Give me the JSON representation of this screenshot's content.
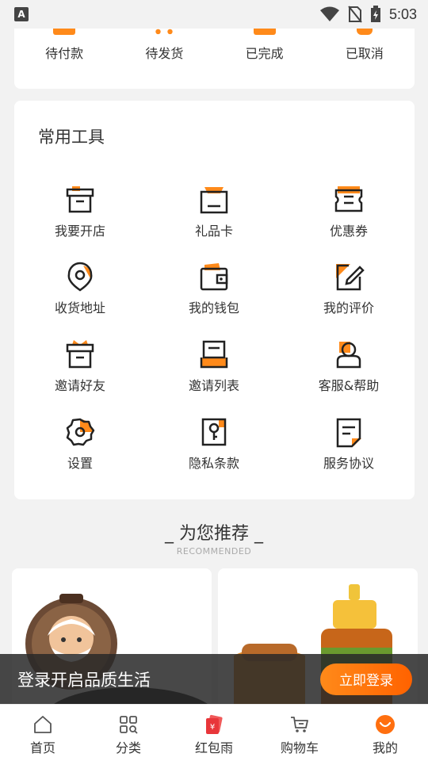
{
  "status_bar": {
    "time": "5:03",
    "app_badge": "A"
  },
  "orders": {
    "items": [
      {
        "label": "待付款"
      },
      {
        "label": "待发货"
      },
      {
        "label": "已完成"
      },
      {
        "label": "已取消"
      }
    ]
  },
  "tools": {
    "title": "常用工具",
    "items": [
      {
        "label": "我要开店",
        "icon": "store-box-icon"
      },
      {
        "label": "礼品卡",
        "icon": "gift-card-icon"
      },
      {
        "label": "优惠券",
        "icon": "coupon-icon"
      },
      {
        "label": "收货地址",
        "icon": "location-pin-icon"
      },
      {
        "label": "我的钱包",
        "icon": "wallet-icon"
      },
      {
        "label": "我的评价",
        "icon": "edit-review-icon"
      },
      {
        "label": "邀请好友",
        "icon": "invite-gift-icon"
      },
      {
        "label": "邀请列表",
        "icon": "invite-list-icon"
      },
      {
        "label": "客服&帮助",
        "icon": "customer-service-icon"
      },
      {
        "label": "设置",
        "icon": "gear-icon"
      },
      {
        "label": "隐私条款",
        "icon": "privacy-key-icon"
      },
      {
        "label": "服务协议",
        "icon": "agreement-doc-icon"
      }
    ]
  },
  "recommended": {
    "title": "_ 为您推荐 _",
    "subtitle": "RECOMMENDED"
  },
  "login_banner": {
    "text": "登录开启品质生活",
    "button": "立即登录"
  },
  "bottom_nav": {
    "items": [
      {
        "label": "首页",
        "icon": "home-icon"
      },
      {
        "label": "分类",
        "icon": "category-icon"
      },
      {
        "label": "红包雨",
        "icon": "red-envelope-icon"
      },
      {
        "label": "购物车",
        "icon": "cart-icon"
      },
      {
        "label": "我的",
        "icon": "profile-smile-icon"
      }
    ]
  },
  "colors": {
    "accent": "#ff8a1a",
    "red": "#e8363a",
    "icon_stroke": "#222222"
  }
}
